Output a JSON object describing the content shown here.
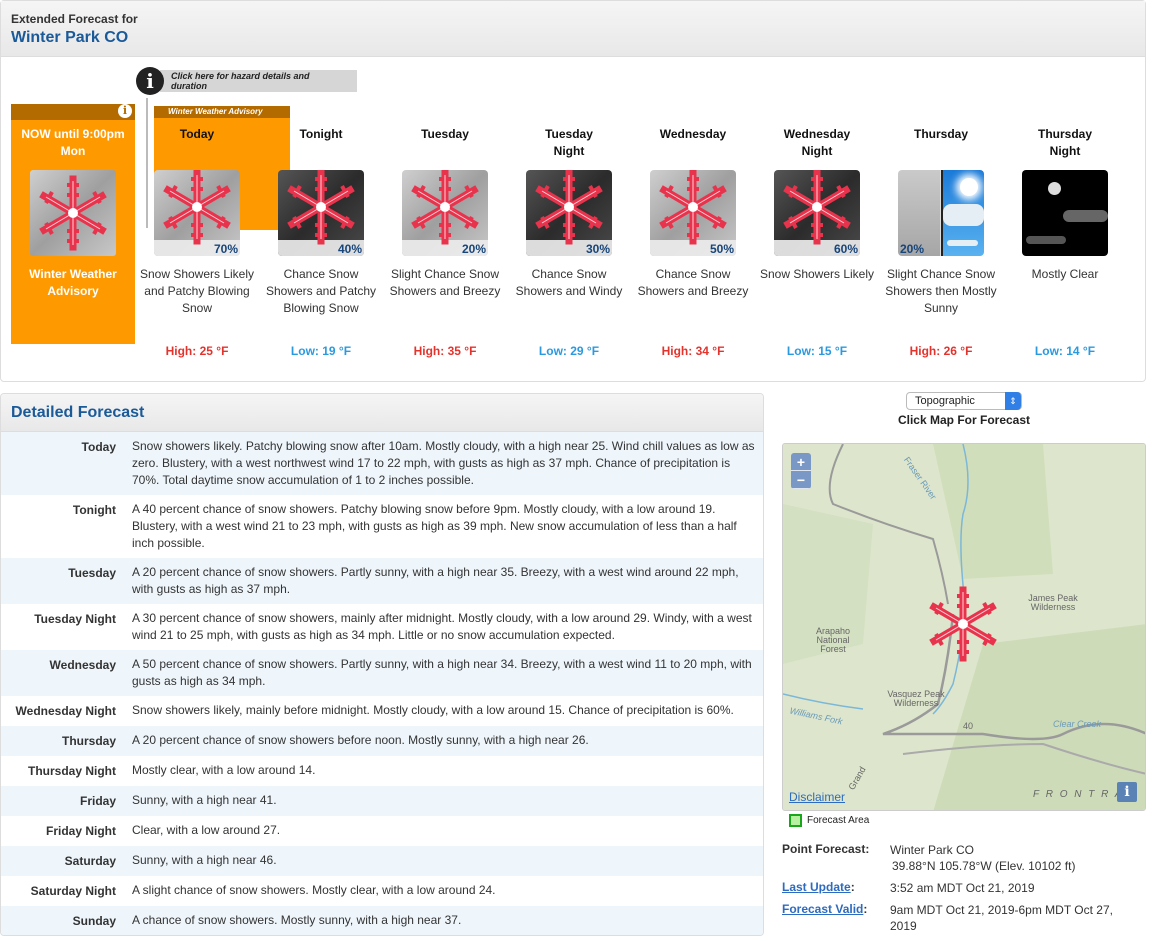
{
  "header": {
    "subtitle": "Extended Forecast for",
    "location": "Winter Park CO"
  },
  "hazard_link": {
    "icon": "info-icon",
    "label": "Click here for hazard details and duration"
  },
  "now_box": {
    "until": "NOW until 9:00pm Mon",
    "label": "Winter Weather Advisory",
    "icon": "snowflake-icon",
    "info_icon": "info-icon"
  },
  "advisory_tab": {
    "label": "Winter Weather Advisory"
  },
  "tombstones": [
    {
      "period": "Today",
      "pop": "70%",
      "short": "Snow Showers Likely and Patchy Blowing Snow",
      "temp": "High: 25 °F",
      "kind": "hi",
      "image": "snow-day"
    },
    {
      "period": "Tonight",
      "pop": "40%",
      "short": "Chance Snow Showers and Patchy Blowing Snow",
      "temp": "Low: 19 °F",
      "kind": "lo",
      "image": "snow-night"
    },
    {
      "period": "Tuesday",
      "pop": "20%",
      "short": "Slight Chance Snow Showers and Breezy",
      "temp": "High: 35 °F",
      "kind": "hi",
      "image": "snow-day"
    },
    {
      "period": "Tuesday Night",
      "pop": "30%",
      "short": "Chance Snow Showers and Windy",
      "temp": "Low: 29 °F",
      "kind": "lo",
      "image": "snow-night"
    },
    {
      "period": "Wednesday",
      "pop": "50%",
      "short": "Chance Snow Showers and Breezy",
      "temp": "High: 34 °F",
      "kind": "hi",
      "image": "snow-day"
    },
    {
      "period": "Wednesday Night",
      "pop": "60%",
      "short": "Snow Showers Likely",
      "temp": "Low: 15 °F",
      "kind": "lo",
      "image": "snow-night"
    },
    {
      "period": "Thursday",
      "pop": "20%",
      "short": "Slight Chance Snow Showers then Mostly Sunny",
      "temp": "High: 26 °F",
      "kind": "hi",
      "image": "snow-then-sunny"
    },
    {
      "period": "Thursday Night",
      "pop": "",
      "short": "Mostly Clear",
      "temp": "Low: 14 °F",
      "kind": "lo",
      "image": "night-mostly-clear"
    }
  ],
  "detailed": {
    "title": "Detailed Forecast",
    "rows": [
      {
        "label": "Today",
        "text": "Snow showers likely. Patchy blowing snow after 10am. Mostly cloudy, with a high near 25. Wind chill values as low as zero. Blustery, with a west northwest wind 17 to 22 mph, with gusts as high as 37 mph. Chance of precipitation is 70%. Total daytime snow accumulation of 1 to 2 inches possible."
      },
      {
        "label": "Tonight",
        "text": "A 40 percent chance of snow showers. Patchy blowing snow before 9pm. Mostly cloudy, with a low around 19. Blustery, with a west wind 21 to 23 mph, with gusts as high as 39 mph. New snow accumulation of less than a half inch possible."
      },
      {
        "label": "Tuesday",
        "text": "A 20 percent chance of snow showers. Partly sunny, with a high near 35. Breezy, with a west wind around 22 mph, with gusts as high as 37 mph."
      },
      {
        "label": "Tuesday Night",
        "text": "A 30 percent chance of snow showers, mainly after midnight. Mostly cloudy, with a low around 29. Windy, with a west wind 21 to 25 mph, with gusts as high as 34 mph. Little or no snow accumulation expected."
      },
      {
        "label": "Wednesday",
        "text": "A 50 percent chance of snow showers. Partly sunny, with a high near 34. Breezy, with a west wind 11 to 20 mph, with gusts as high as 34 mph."
      },
      {
        "label": "Wednesday Night",
        "text": "Snow showers likely, mainly before midnight. Mostly cloudy, with a low around 15. Chance of precipitation is 60%."
      },
      {
        "label": "Thursday",
        "text": "A 20 percent chance of snow showers before noon. Mostly sunny, with a high near 26."
      },
      {
        "label": "Thursday Night",
        "text": "Mostly clear, with a low around 14."
      },
      {
        "label": "Friday",
        "text": "Sunny, with a high near 41."
      },
      {
        "label": "Friday Night",
        "text": "Clear, with a low around 27."
      },
      {
        "label": "Saturday",
        "text": "Sunny, with a high near 46."
      },
      {
        "label": "Saturday Night",
        "text": "A slight chance of snow showers. Mostly clear, with a low around 24."
      },
      {
        "label": "Sunday",
        "text": "A chance of snow showers. Mostly sunny, with a high near 37."
      }
    ]
  },
  "map": {
    "layer_select": "Topographic",
    "click_hint": "Click Map For Forecast",
    "zoom_in": "+",
    "zoom_out": "−",
    "disclaimer": "Disclaimer",
    "info": "i",
    "labels": {
      "fraser": "Fraser River",
      "james": "James Peak Wilderness",
      "arapaho": "Arapaho National Forest",
      "vasquez": "Vasquez Peak Wilderness",
      "williams": "Williams Fork",
      "clear_creek": "Clear Creek",
      "hwy": "40",
      "grand": "Grand",
      "front": "F R O N T   R A"
    },
    "legend": "Forecast Area"
  },
  "point_info": {
    "point_label": "Point Forecast:",
    "point_name": "Winter Park CO",
    "point_coords": "39.88°N 105.78°W (Elev. 10102 ft)",
    "update_label": "Last Update",
    "update_value": "3:52 am MDT Oct 21, 2019",
    "valid_label": "Forecast Valid",
    "valid_value": "9am MDT Oct 21, 2019-6pm MDT Oct 27, 2019"
  },
  "colors": {
    "advisory": "#ff9900",
    "advisory_dark": "#b36b00",
    "high": "#e3332d",
    "low": "#2a9ae0",
    "title_blue": "#1b5a99"
  }
}
